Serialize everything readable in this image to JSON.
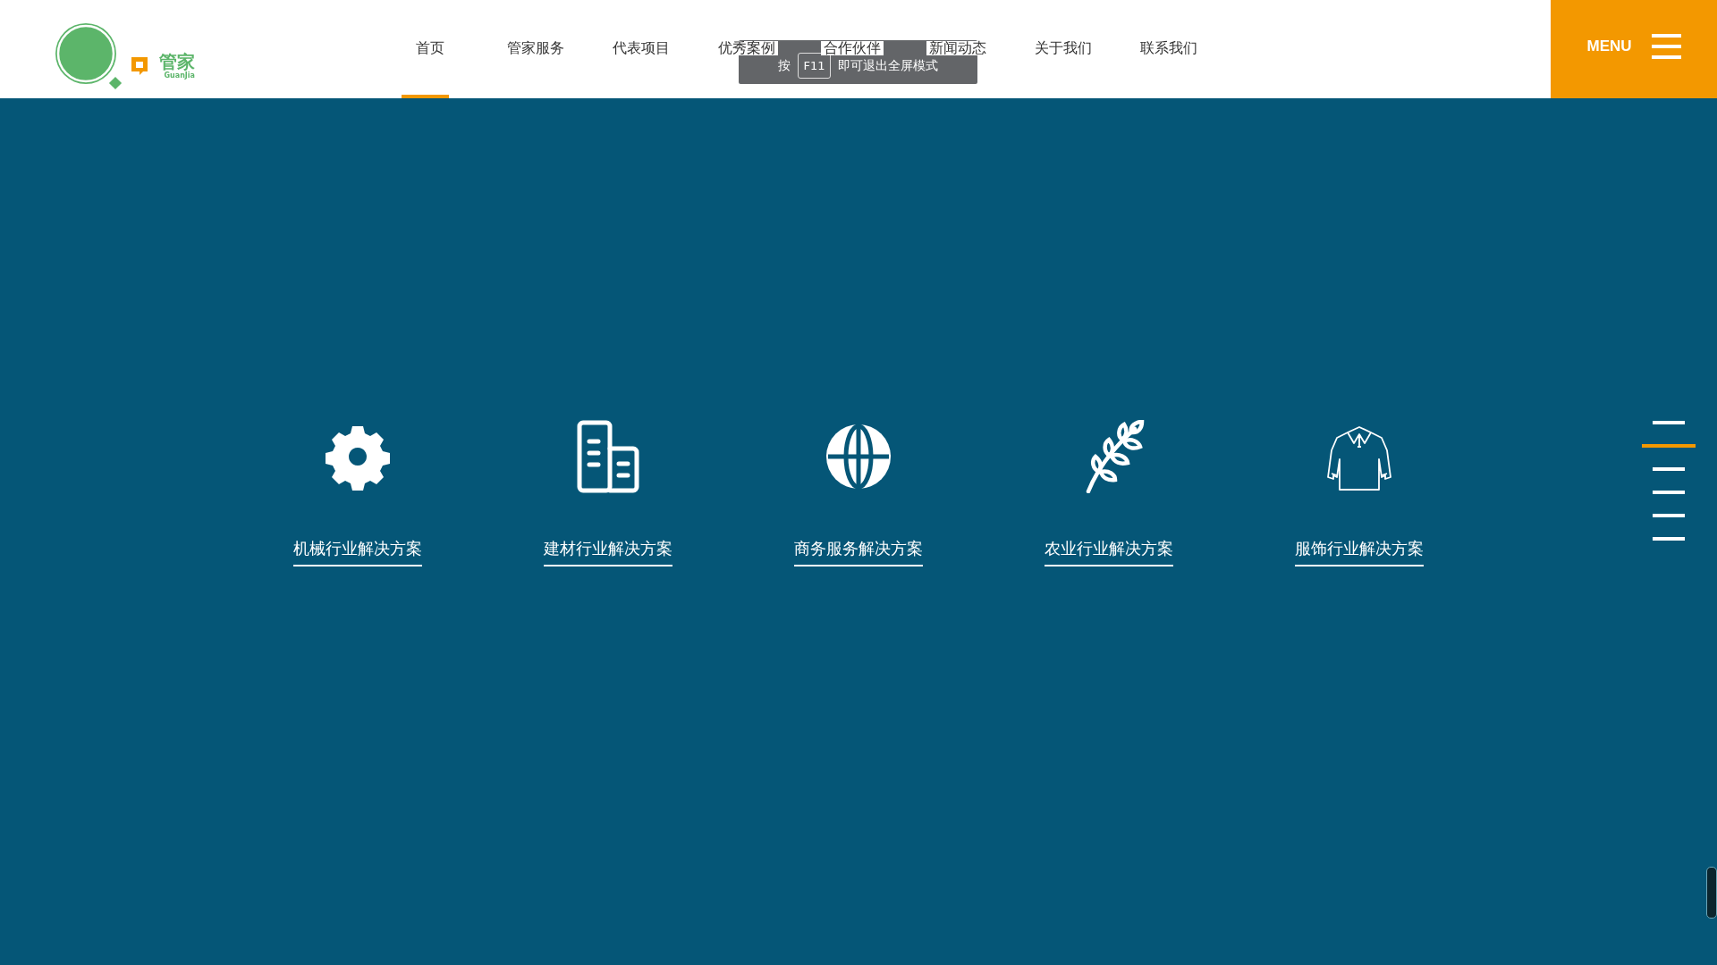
{
  "logo": {
    "name": "管家",
    "latin": "GuanJia"
  },
  "nav": [
    {
      "label": "首页",
      "selected": true
    },
    {
      "label": "管家服务",
      "selected": false
    },
    {
      "label": "代表项目",
      "selected": false
    },
    {
      "label": "优秀案例",
      "selected": false
    },
    {
      "label": "合作伙伴",
      "selected": false
    },
    {
      "label": "新闻动态",
      "selected": false
    },
    {
      "label": "关于我们",
      "selected": false
    },
    {
      "label": "联系我们",
      "selected": false
    }
  ],
  "fullscreen_notice": {
    "before": "按",
    "key": "F11",
    "after": "即可退出全屏模式"
  },
  "menu_button": {
    "label": "MENU"
  },
  "solutions": [
    {
      "kind": "gear",
      "label": "机械行业解决方案"
    },
    {
      "kind": "building",
      "label": "建材行业解决方案"
    },
    {
      "kind": "globe",
      "label": "商务服务解决方案"
    },
    {
      "kind": "branch",
      "label": "农业行业解决方案"
    },
    {
      "kind": "shirt",
      "label": "服饰行业解决方案"
    }
  ],
  "side_nav": [
    {
      "selected": false
    },
    {
      "selected": true
    },
    {
      "selected": false
    },
    {
      "selected": false
    },
    {
      "selected": false
    },
    {
      "selected": false
    }
  ]
}
